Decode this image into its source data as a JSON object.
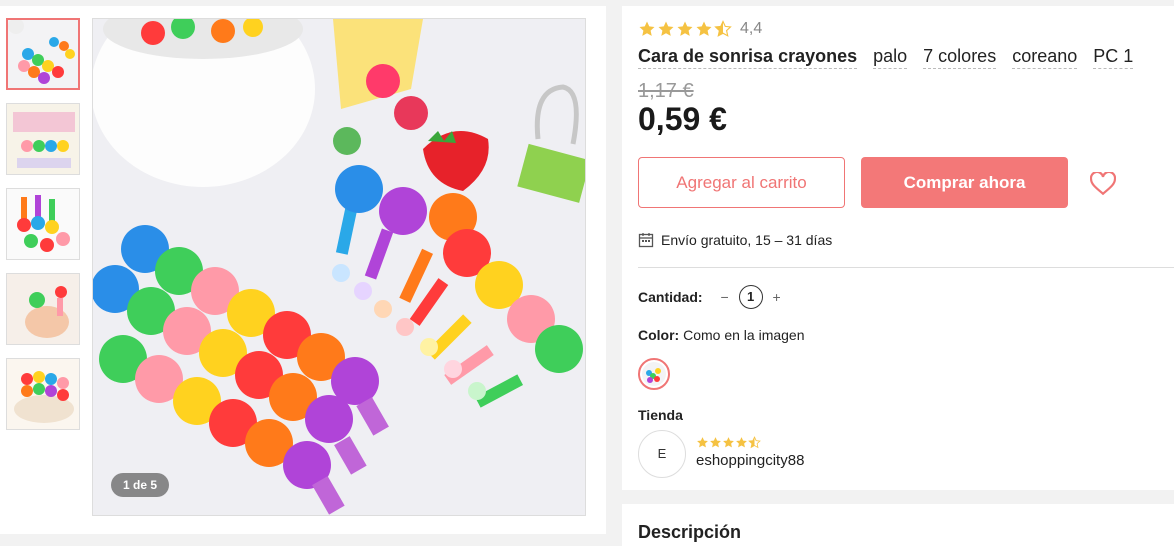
{
  "gallery": {
    "counter": "1 de 5",
    "thumbnails": [
      "thumbnail-1",
      "thumbnail-2",
      "thumbnail-3",
      "thumbnail-4",
      "thumbnail-5"
    ]
  },
  "product": {
    "rating_value": "4,4",
    "rating": 4.4,
    "title_parts": [
      "Cara de sonrisa crayones",
      "palo",
      "7 colores",
      "coreano",
      "PC 1"
    ],
    "old_price": "1,17 €",
    "price": "0,59 €",
    "add_to_cart": "Agregar al carrito",
    "buy_now": "Comprar ahora",
    "shipping": "Envío gratuito, 15 – 31 días",
    "quantity_label": "Cantidad:",
    "quantity_minus": "−",
    "quantity_value": "1",
    "quantity_plus": "+",
    "color_label": "Color:",
    "color_value": " Como en la imagen"
  },
  "store": {
    "label": "Tienda",
    "avatar_letter": "E",
    "name": "eshoppingcity88",
    "rating": 4.5
  },
  "description": {
    "title": "Descripción"
  },
  "colors": {
    "accent": "#f37878",
    "star": "#f5c242"
  }
}
